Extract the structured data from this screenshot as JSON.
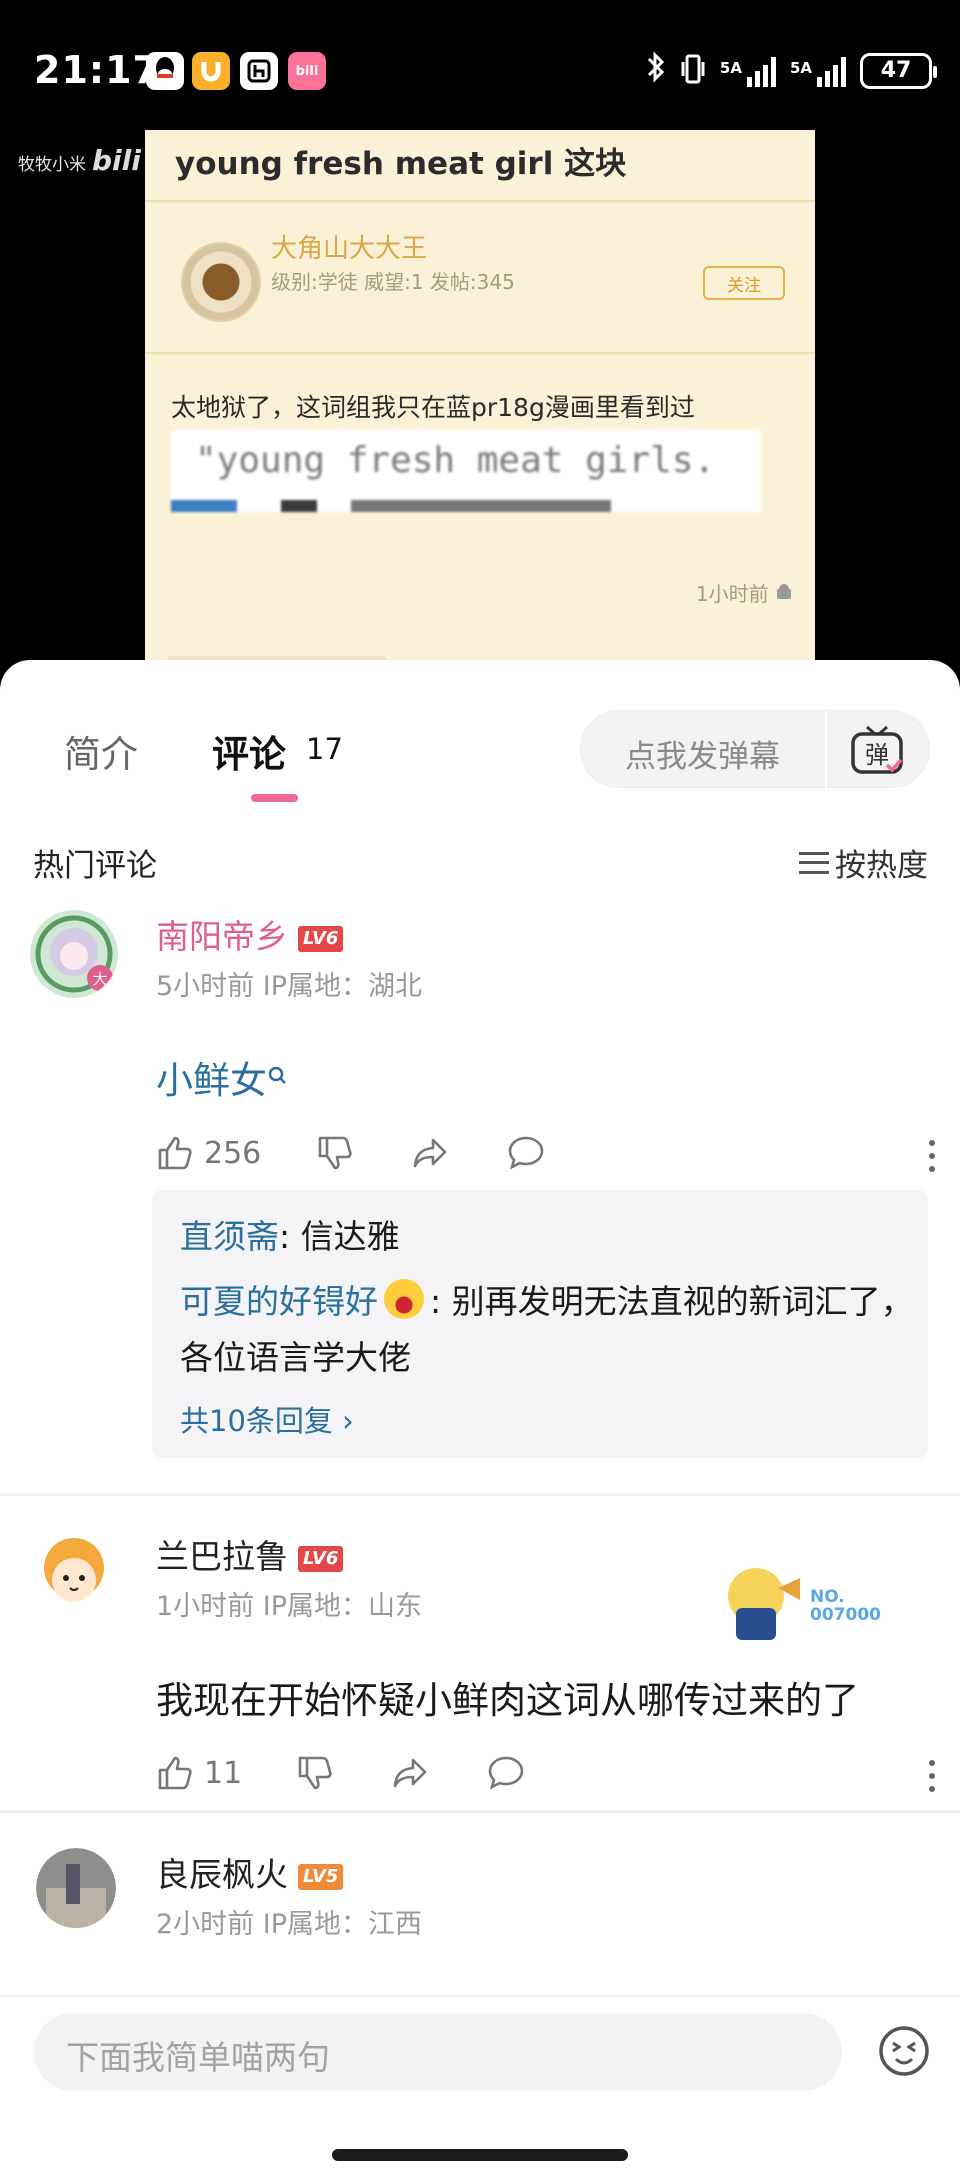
{
  "status_bar": {
    "time": "21:17",
    "network": "5A",
    "battery": "47",
    "apps": [
      "qq-icon",
      "ushare-icon",
      "h-icon",
      "bilibili-icon"
    ]
  },
  "video": {
    "watermark_user": "牧牧小米",
    "watermark_logo": "bili",
    "title": "young fresh meat girl 这块",
    "post_author": "大角山大大王",
    "post_meta": "级别:学徒 威望:1 发帖:345",
    "follow": "关注",
    "post_text": "太地狱了，这词组我只在蓝pr18g漫画里看到过",
    "quote": "\"young fresh meat girls.",
    "post_time": "1小时前"
  },
  "tabs": {
    "intro": "简介",
    "comments": "评论",
    "comments_count": "17",
    "danmu_placeholder": "点我发弹幕",
    "danmu_icon_char": "弹"
  },
  "section": {
    "hot": "热门评论",
    "sort": "按热度"
  },
  "comments": [
    {
      "name": "南阳帝乡",
      "level": "LV6",
      "meta": "5小时前 IP属地：湖北",
      "text": "小鲜女",
      "likes": "256",
      "replies": [
        {
          "user": "直须斋",
          "text": ": 信达雅"
        },
        {
          "user": "可夏的好锝好",
          "text": ": 别再发明无法直视的新词汇了，各位语言学大佬"
        }
      ],
      "more_replies": "共10条回复 ›"
    },
    {
      "name": "兰巴拉鲁",
      "level": "LV6",
      "meta": "1小时前 IP属地：山东",
      "text": "我现在开始怀疑小鲜肉这词从哪传过来的了",
      "likes": "11",
      "badge": "NO.\n007000"
    },
    {
      "name": "良辰枫火",
      "level": "LV5",
      "meta": "2小时前 IP属地：江西"
    }
  ],
  "input": {
    "placeholder": "下面我简单喵两句"
  },
  "colors": {
    "accent": "#f06a93",
    "link": "#2a6f9e",
    "name_pink": "#e05f8c"
  }
}
